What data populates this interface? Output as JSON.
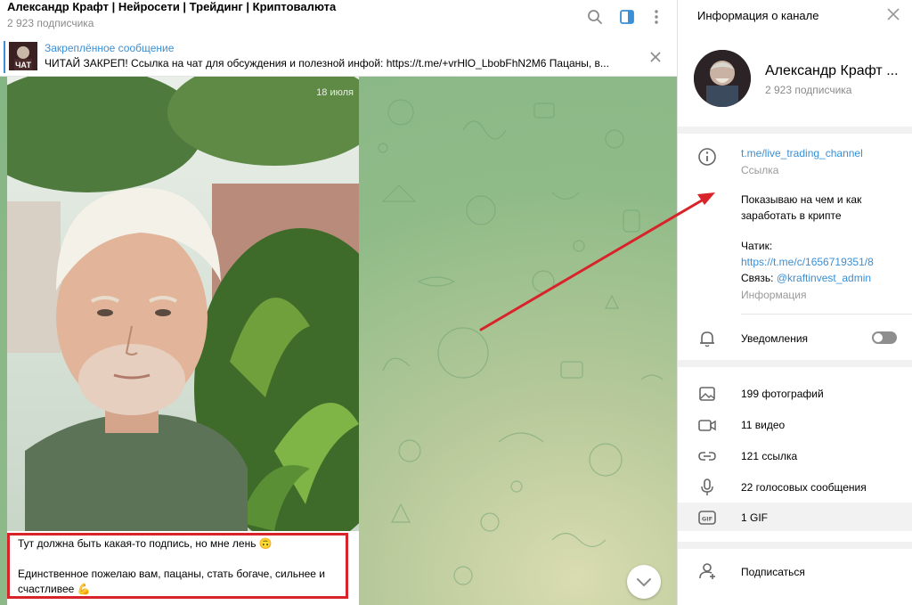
{
  "header": {
    "title": "Александр Крафт | Нейросети | Трейдинг | Криптовалюта",
    "subtitle": "2 923 подписчика",
    "icons": [
      "search-icon",
      "sidebar-toggle-icon",
      "more-vertical-icon"
    ]
  },
  "pinned": {
    "title": "Закреплённое сообщение",
    "text": "ЧИТАЙ ЗАКРЕП!  Ссылка на чат для обсуждения и полезной инфой: https://t.me/+vrHlO_LbobFhN2M6  Пацаны, в...",
    "thumb_label": "ЧАТ"
  },
  "message": {
    "date": "18 июля",
    "caption_line1": "Тут должна быть какая-то подпись, но мне лень 🙃",
    "caption_line2": "Единственное пожелаю вам, пацаны, стать богаче, сильнее и счастливее 💪"
  },
  "panel": {
    "header_title": "Информация о канале",
    "channel_name": "Александр Крафт ...",
    "subscribers": "2 923 подписчика",
    "link": "t.me/live_trading_channel",
    "link_label": "Ссылка",
    "description_line1": "Показываю на чем и как",
    "description_line2": "заработать в крипте",
    "chat_label": "Чатик:",
    "chat_link": "https://t.me/c/1656719351/8",
    "contact_label": "Связь:",
    "contact_handle": "@kraftinvest_admin",
    "info_label": "Информация",
    "notifications": "Уведомления",
    "notifications_on": false,
    "media": [
      {
        "label": "199 фотографий",
        "icon": "photo-icon"
      },
      {
        "label": "11 видео",
        "icon": "video-icon"
      },
      {
        "label": "121 ссылка",
        "icon": "link-icon"
      },
      {
        "label": "22 голосовых сообщения",
        "icon": "microphone-icon"
      },
      {
        "label": "1 GIF",
        "icon": "gif-icon"
      }
    ],
    "subscribe": "Подписаться"
  },
  "colors": {
    "accent": "#3a8fd5",
    "highlight_red": "#d8232a",
    "chat_bg": "#86b585"
  }
}
